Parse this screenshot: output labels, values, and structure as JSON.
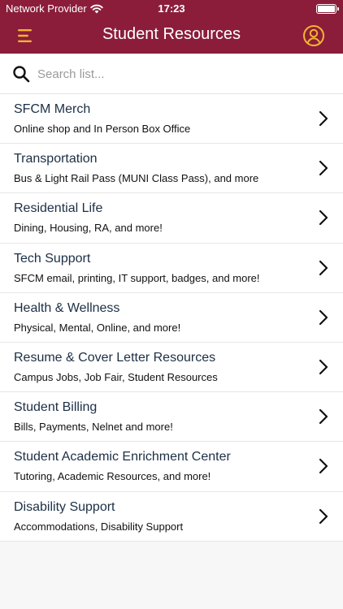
{
  "status_bar": {
    "carrier": "Network Provider",
    "time": "17:23",
    "wifi_icon": "wifi-icon",
    "battery_icon": "battery-icon"
  },
  "nav": {
    "title": "Student Resources",
    "menu_icon": "hamburger-menu-icon",
    "profile_icon": "user-circle-icon"
  },
  "search": {
    "placeholder": "Search list...",
    "value": "",
    "icon": "search-icon"
  },
  "colors": {
    "header_bg": "#8b1d3b",
    "accent_icon": "#f2b530",
    "title_text": "#1c2f45"
  },
  "items": [
    {
      "title": "SFCM Merch",
      "subtitle": "Online shop and In Person Box Office"
    },
    {
      "title": "Transportation",
      "subtitle": "Bus & Light Rail Pass (MUNI Class Pass), and more"
    },
    {
      "title": "Residential Life",
      "subtitle": "Dining, Housing, RA, and more!"
    },
    {
      "title": "Tech Support",
      "subtitle": "SFCM email, printing, IT support, badges, and more!"
    },
    {
      "title": "Health & Wellness",
      "subtitle": "Physical, Mental, Online, and more!"
    },
    {
      "title": "Resume & Cover Letter Resources",
      "subtitle": "Campus Jobs, Job Fair, Student Resources"
    },
    {
      "title": "Student Billing",
      "subtitle": "Bills, Payments, Nelnet and more!"
    },
    {
      "title": "Student Academic Enrichment Center",
      "subtitle": "Tutoring, Academic Resources, and more!"
    },
    {
      "title": "Disability Support",
      "subtitle": "Accommodations, Disability Support"
    }
  ]
}
